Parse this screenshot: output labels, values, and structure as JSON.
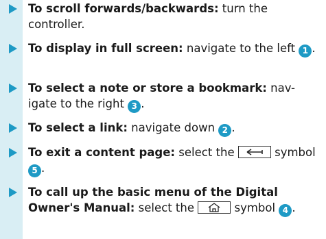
{
  "items": [
    {
      "bold": "To scroll forwards/backwards:",
      "text": " turn the controller."
    },
    {
      "bold": "To display in full screen:",
      "text": " navigate to the left ",
      "num": "1",
      "after": "."
    },
    {
      "bold": "To select a note or store a bookmark:",
      "text": " nav-igate to the right ",
      "num": "3",
      "after": "."
    },
    {
      "bold": "To select a link:",
      "text": " navigate down ",
      "num": "2",
      "after": "."
    },
    {
      "bold": "To exit a content page:",
      "text": " select the ",
      "symbol": "back-arrow-icon",
      "text2": " symbol ",
      "num": "5",
      "after": "."
    },
    {
      "bold": "To call up the basic menu of the Digital Owner's Manual:",
      "text": " select the ",
      "symbol": "home-icon",
      "text2": " symbol ",
      "num": "4",
      "after": "."
    }
  ],
  "colors": {
    "accent": "#1e9ac5",
    "band": "#d9eef4"
  }
}
